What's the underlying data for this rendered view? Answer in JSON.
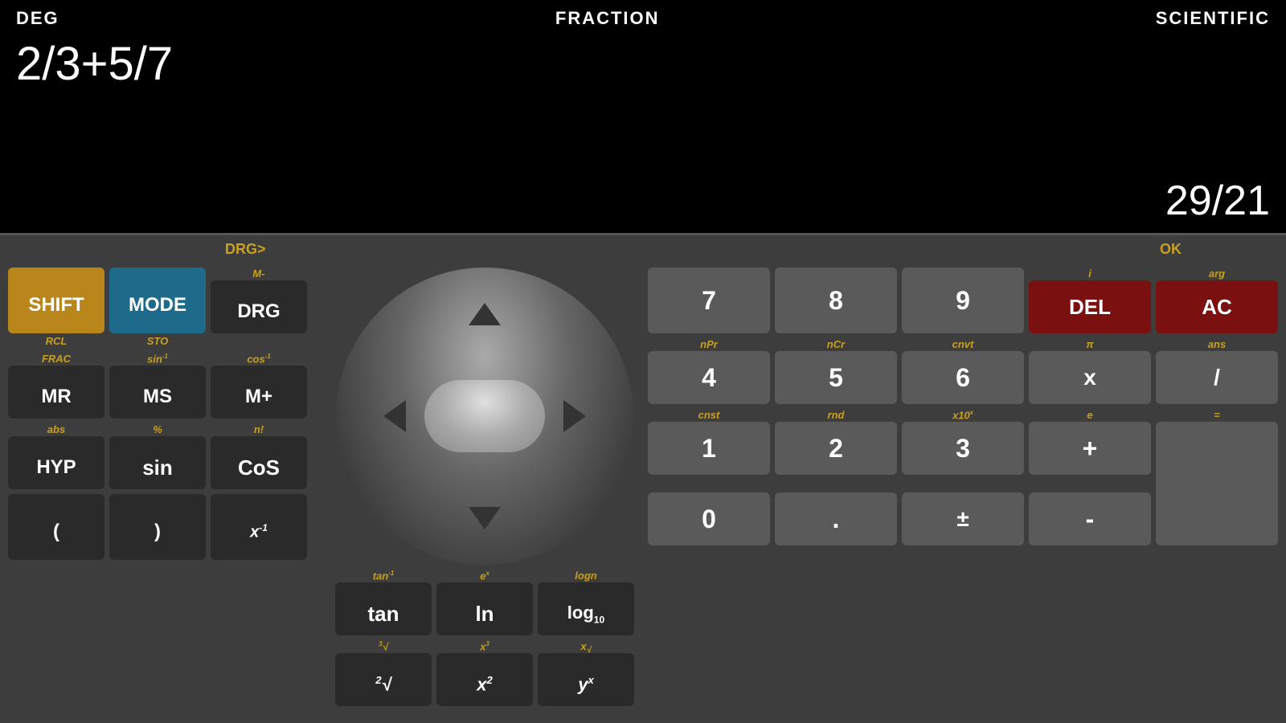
{
  "display": {
    "top_labels": {
      "deg": "DEG",
      "fraction": "FRACTION",
      "scientific": "SCIENTIFIC"
    },
    "expression": "2/3+5/7",
    "result": "29/21"
  },
  "keyboard": {
    "drg_label": "DRG>",
    "ok_label": "OK",
    "left_section": {
      "row1": [
        {
          "id": "shift",
          "main": "SHIFT",
          "sub": "",
          "style": "gold"
        },
        {
          "id": "mode",
          "main": "MODE",
          "sub": "",
          "style": "blue"
        },
        {
          "id": "drg",
          "main": "DRG",
          "sub": "",
          "style": "dark"
        }
      ],
      "row1_sublabels": [
        "RCL",
        "STO",
        "M-"
      ],
      "row2": [
        {
          "id": "mr",
          "main": "MR",
          "sub": "",
          "style": "dark"
        },
        {
          "id": "ms",
          "main": "MS",
          "sub": "",
          "style": "dark"
        },
        {
          "id": "mplus",
          "main": "M+",
          "sub": "",
          "style": "dark"
        }
      ],
      "row2_sublabels": [
        "FRAC",
        "sin⁻¹",
        "cos⁻¹"
      ],
      "row3": [
        {
          "id": "hyp",
          "main": "HYP",
          "sub": "",
          "style": "dark"
        },
        {
          "id": "sin",
          "main": "sin",
          "sub": "",
          "style": "dark"
        },
        {
          "id": "cos",
          "main": "CoS",
          "sub": "",
          "style": "dark"
        }
      ],
      "row3_sublabels": [
        "abs",
        "%",
        "n!"
      ],
      "row4": [
        {
          "id": "paren-open",
          "main": "(",
          "sub": "",
          "style": "dark"
        },
        {
          "id": "paren-close",
          "main": ")",
          "sub": "",
          "style": "dark"
        },
        {
          "id": "x-inv",
          "main": "x⁻¹",
          "sub": "",
          "style": "dark"
        }
      ]
    },
    "middle_section": {
      "row2_sublabels": [
        "tan⁻¹",
        "eˣ",
        "logn"
      ],
      "row3": [
        {
          "id": "tan",
          "main": "tan",
          "sub": "",
          "style": "dark"
        },
        {
          "id": "ln",
          "main": "ln",
          "sub": "",
          "style": "dark"
        },
        {
          "id": "log10",
          "main": "log₁₀",
          "sub": "",
          "style": "dark"
        }
      ],
      "row3_sublabels": [
        "³√",
        "x³",
        "x√"
      ],
      "row4": [
        {
          "id": "sqrt2",
          "main": "²√",
          "sub": "",
          "style": "dark"
        },
        {
          "id": "xsq",
          "main": "x²",
          "sub": "",
          "style": "dark"
        },
        {
          "id": "yx",
          "main": "yˣ",
          "sub": "",
          "style": "dark"
        }
      ]
    },
    "right_section": {
      "row1": [
        {
          "id": "7",
          "main": "7",
          "sub": "",
          "style": "gray"
        },
        {
          "id": "8",
          "main": "8",
          "sub": "",
          "style": "gray"
        },
        {
          "id": "9",
          "main": "9",
          "sub": "",
          "style": "gray"
        },
        {
          "id": "del",
          "main": "DEL",
          "sub": "",
          "style": "red"
        },
        {
          "id": "ac",
          "main": "AC",
          "sub": "",
          "style": "red"
        }
      ],
      "row1_sublabels": [
        "",
        "",
        "",
        "i",
        "arg"
      ],
      "row2": [
        {
          "id": "4",
          "main": "4",
          "sub": "",
          "style": "gray"
        },
        {
          "id": "5",
          "main": "5",
          "sub": "",
          "style": "gray"
        },
        {
          "id": "6",
          "main": "6",
          "sub": "",
          "style": "gray"
        },
        {
          "id": "x",
          "main": "x",
          "sub": "",
          "style": "gray"
        },
        {
          "id": "div",
          "main": "/",
          "sub": "",
          "style": "gray"
        }
      ],
      "row2_sublabels": [
        "nPr",
        "nCr",
        "cnvt",
        "π",
        "ans"
      ],
      "row3": [
        {
          "id": "1",
          "main": "1",
          "sub": "",
          "style": "gray"
        },
        {
          "id": "2",
          "main": "2",
          "sub": "",
          "style": "gray"
        },
        {
          "id": "3",
          "main": "3",
          "sub": "",
          "style": "gray"
        },
        {
          "id": "plus",
          "main": "+",
          "sub": "",
          "style": "gray"
        },
        {
          "id": "equals",
          "main": "",
          "sub": "",
          "style": "gray"
        }
      ],
      "row3_sublabels": [
        "cnst",
        "rnd",
        "x10ˣ",
        "e",
        "="
      ],
      "row4": [
        {
          "id": "0",
          "main": "0",
          "sub": "",
          "style": "gray"
        },
        {
          "id": "dot",
          "main": ".",
          "sub": "",
          "style": "gray"
        },
        {
          "id": "plusminus",
          "main": "±",
          "sub": "",
          "style": "gray"
        },
        {
          "id": "minus",
          "main": "-",
          "sub": "",
          "style": "gray"
        },
        {
          "id": "equals-big",
          "main": "",
          "sub": "",
          "style": "gray"
        }
      ]
    }
  }
}
